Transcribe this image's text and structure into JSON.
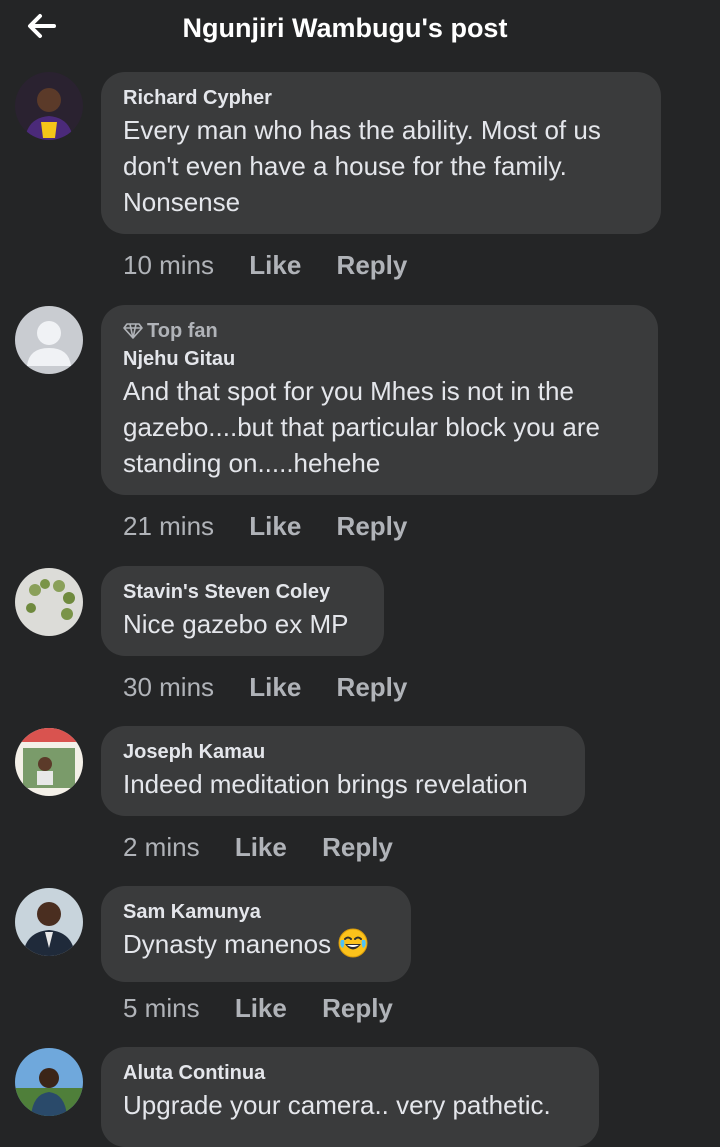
{
  "header": {
    "title": "Ngunjiri Wambugu's post",
    "back_icon": "arrow-left-icon"
  },
  "comments": [
    {
      "author": "Richard Cypher",
      "top_fan": "",
      "text_lines": [
        "Every man who has the ability. Most of us",
        "don't even have a house for the family.",
        "Nonsense"
      ],
      "time": "10 mins",
      "like": "Like",
      "reply": "Reply"
    },
    {
      "author": "Njehu Gitau",
      "top_fan": "Top fan",
      "text_lines": [
        "And that spot for you Mhes is not in the",
        "gazebo....but that particular block you are",
        "standing on.....hehehe"
      ],
      "time": "21 mins",
      "like": "Like",
      "reply": "Reply"
    },
    {
      "author": "Stavin's Steven Coley",
      "top_fan": "",
      "text_lines": [
        "Nice gazebo ex MP"
      ],
      "time": "30 mins",
      "like": "Like",
      "reply": "Reply"
    },
    {
      "author": "Joseph Kamau",
      "top_fan": "",
      "text_lines": [
        "Indeed meditation brings revelation"
      ],
      "time": "2 mins",
      "like": "Like",
      "reply": "Reply"
    },
    {
      "author": "Sam Kamunya",
      "top_fan": "",
      "text_lines": [
        "Dynasty manenos"
      ],
      "emoji": "face-with-tears-of-joy-emoji",
      "time": "5 mins",
      "like": "Like",
      "reply": "Reply"
    },
    {
      "author": "Aluta Continua",
      "top_fan": "",
      "text_lines": [
        "Upgrade your camera.. very pathetic."
      ],
      "time": "",
      "like": "",
      "reply": ""
    }
  ],
  "colors": {
    "background": "#242526",
    "bubble": "#3a3b3c",
    "primary_text": "#e4e6eb",
    "secondary_text": "#b0b3b8"
  }
}
